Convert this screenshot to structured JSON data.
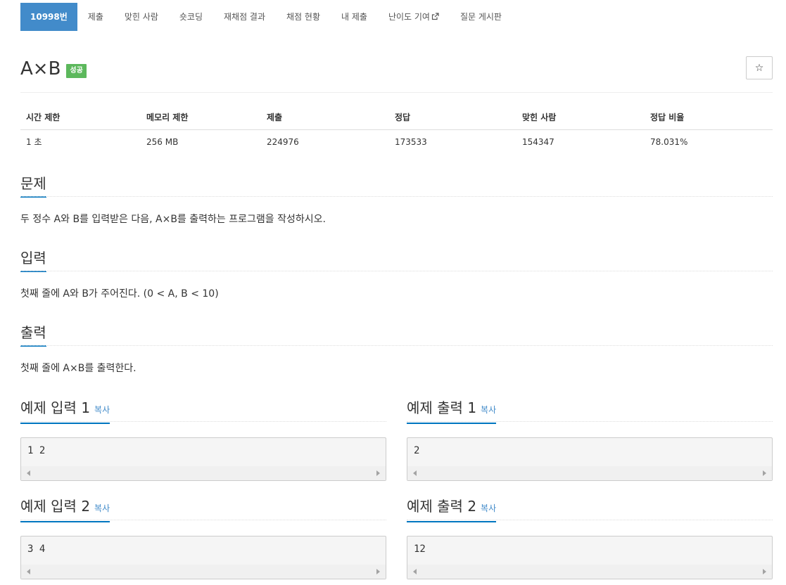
{
  "nav": {
    "items": [
      {
        "label": "10998번"
      },
      {
        "label": "제출"
      },
      {
        "label": "맞힌 사람"
      },
      {
        "label": "숏코딩"
      },
      {
        "label": "재채점 결과"
      },
      {
        "label": "채점 현황"
      },
      {
        "label": "내 제출"
      },
      {
        "label": "난이도 기여"
      },
      {
        "label": "질문 게시판"
      }
    ],
    "active_index": 0
  },
  "problem": {
    "title": "A×B",
    "badge": "성공",
    "star": "☆"
  },
  "info": {
    "headers": [
      "시간 제한",
      "메모리 제한",
      "제출",
      "정답",
      "맞힌 사람",
      "정답 비율"
    ],
    "values": [
      "1 초",
      "256 MB",
      "224976",
      "173533",
      "154347",
      "78.031%"
    ]
  },
  "sections": {
    "problem": {
      "title": "문제",
      "text": "두 정수 A와 B를 입력받은 다음, A×B를 출력하는 프로그램을 작성하시오."
    },
    "input": {
      "title": "입력",
      "text": "첫째 줄에 A와 B가 주어진다. (0 < A, B < 10)"
    },
    "output": {
      "title": "출력",
      "text": "첫째 줄에 A×B를 출력한다."
    }
  },
  "samples": {
    "copy_label": "복사",
    "in1": {
      "title": "예제 입력 1",
      "content": "1 2"
    },
    "out1": {
      "title": "예제 출력 1",
      "content": "2"
    },
    "in2": {
      "title": "예제 입력 2",
      "content": "3 4"
    },
    "out2": {
      "title": "예제 출력 2",
      "content": "12"
    }
  },
  "colors": {
    "accent": "#428bca",
    "success": "#5cb85c",
    "underline": "#0076c0"
  }
}
